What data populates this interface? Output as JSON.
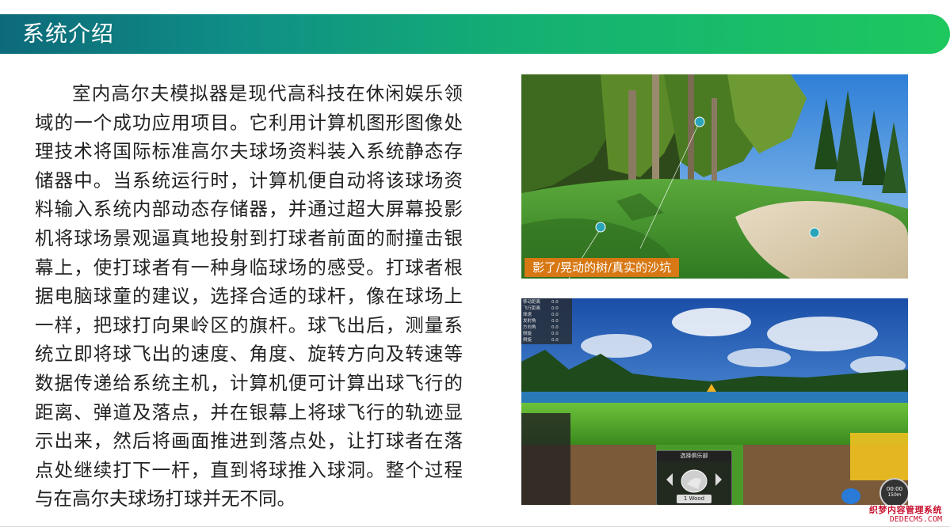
{
  "header": {
    "title": "系统介绍"
  },
  "body": {
    "paragraph": "室内高尔夫模拟器是现代高科技在休闲娱乐领域的一个成功应用项目。它利用计算机图形图像处理技术将国际标准高尔夫球场资料装入系统静态存储器中。当系统运行时，计算机便自动将该球场资料输入系统内部动态存储器，并通过超大屏幕投影机将球场景观逼真地投射到打球者前面的耐撞击银幕上，使打球者有一种身临球场的感受。打球者根据电脑球童的建议，选择合适的球杆，像在球场上一样，把球打向果岭区的旗杆。球飞出后，测量系统立即将球飞出的速度、角度、旋转方向及转速等数据传递给系统主机，计算机便可计算出球飞行的距离、弹道及落点，并在银幕上将球飞行的轨迹显示出来，然后将画面推进到落点处，让打球者在落点处继续打下一杆，直到将球推入球洞。整个过程与在高尔夫球场打球并无不同。"
  },
  "screenshot1": {
    "caption": "影了/晃动的树/真实的沙坑"
  },
  "screenshot2": {
    "hud_rows": [
      {
        "label": "移动距离",
        "value": "0.0"
      },
      {
        "label": "飞行距离",
        "value": "0.0"
      },
      {
        "label": "球速",
        "value": "0.0"
      },
      {
        "label": "发射角",
        "value": "0.0"
      },
      {
        "label": "方向角",
        "value": "0.0"
      },
      {
        "label": "侧旋",
        "value": "0.0"
      },
      {
        "label": "倒旋",
        "value": "0.0"
      }
    ],
    "club_selector_title": "选择俱乐部",
    "club_name": "1 Wood",
    "timer": "00:00",
    "distance": "150m"
  },
  "watermark": {
    "line1": "织梦内容管理系统",
    "line2": "DEDECMS.COM"
  },
  "colors": {
    "header_start": "#0d6a7a",
    "header_end": "#1ec85f",
    "caption_bg": "#e67814"
  }
}
